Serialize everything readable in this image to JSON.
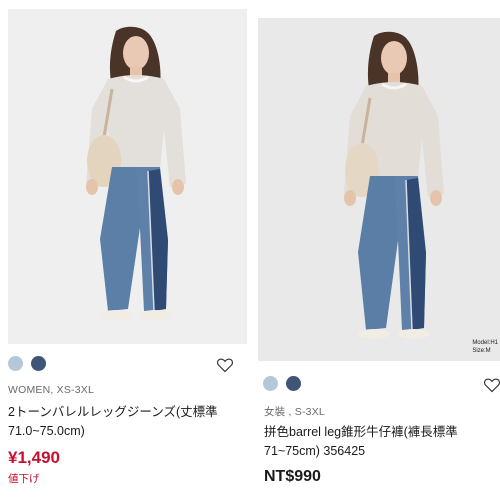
{
  "cards": [
    {
      "colors": {
        "swatch1": "#b4c8da",
        "swatch2": "#3e5577"
      },
      "meta": "WOMEN, XS-3XL",
      "title": "2トーンバレルレッグジーンズ(丈標準71.0~75.0cm)",
      "price": "¥1,490",
      "tag": "値下げ",
      "favorite_icon": "heart-outline-icon"
    },
    {
      "colors": {
        "swatch1": "#b4c8da",
        "swatch2": "#3e5577"
      },
      "model_info": {
        "line1": "Model:H1",
        "line2": "Size:M"
      },
      "meta": "女裝 , S-3XL",
      "title": "拼色barrel leg錐形牛仔褲(褲長標準71~75cm) 356425",
      "price": "NT$990",
      "favorite_icon": "heart-outline-icon"
    }
  ]
}
